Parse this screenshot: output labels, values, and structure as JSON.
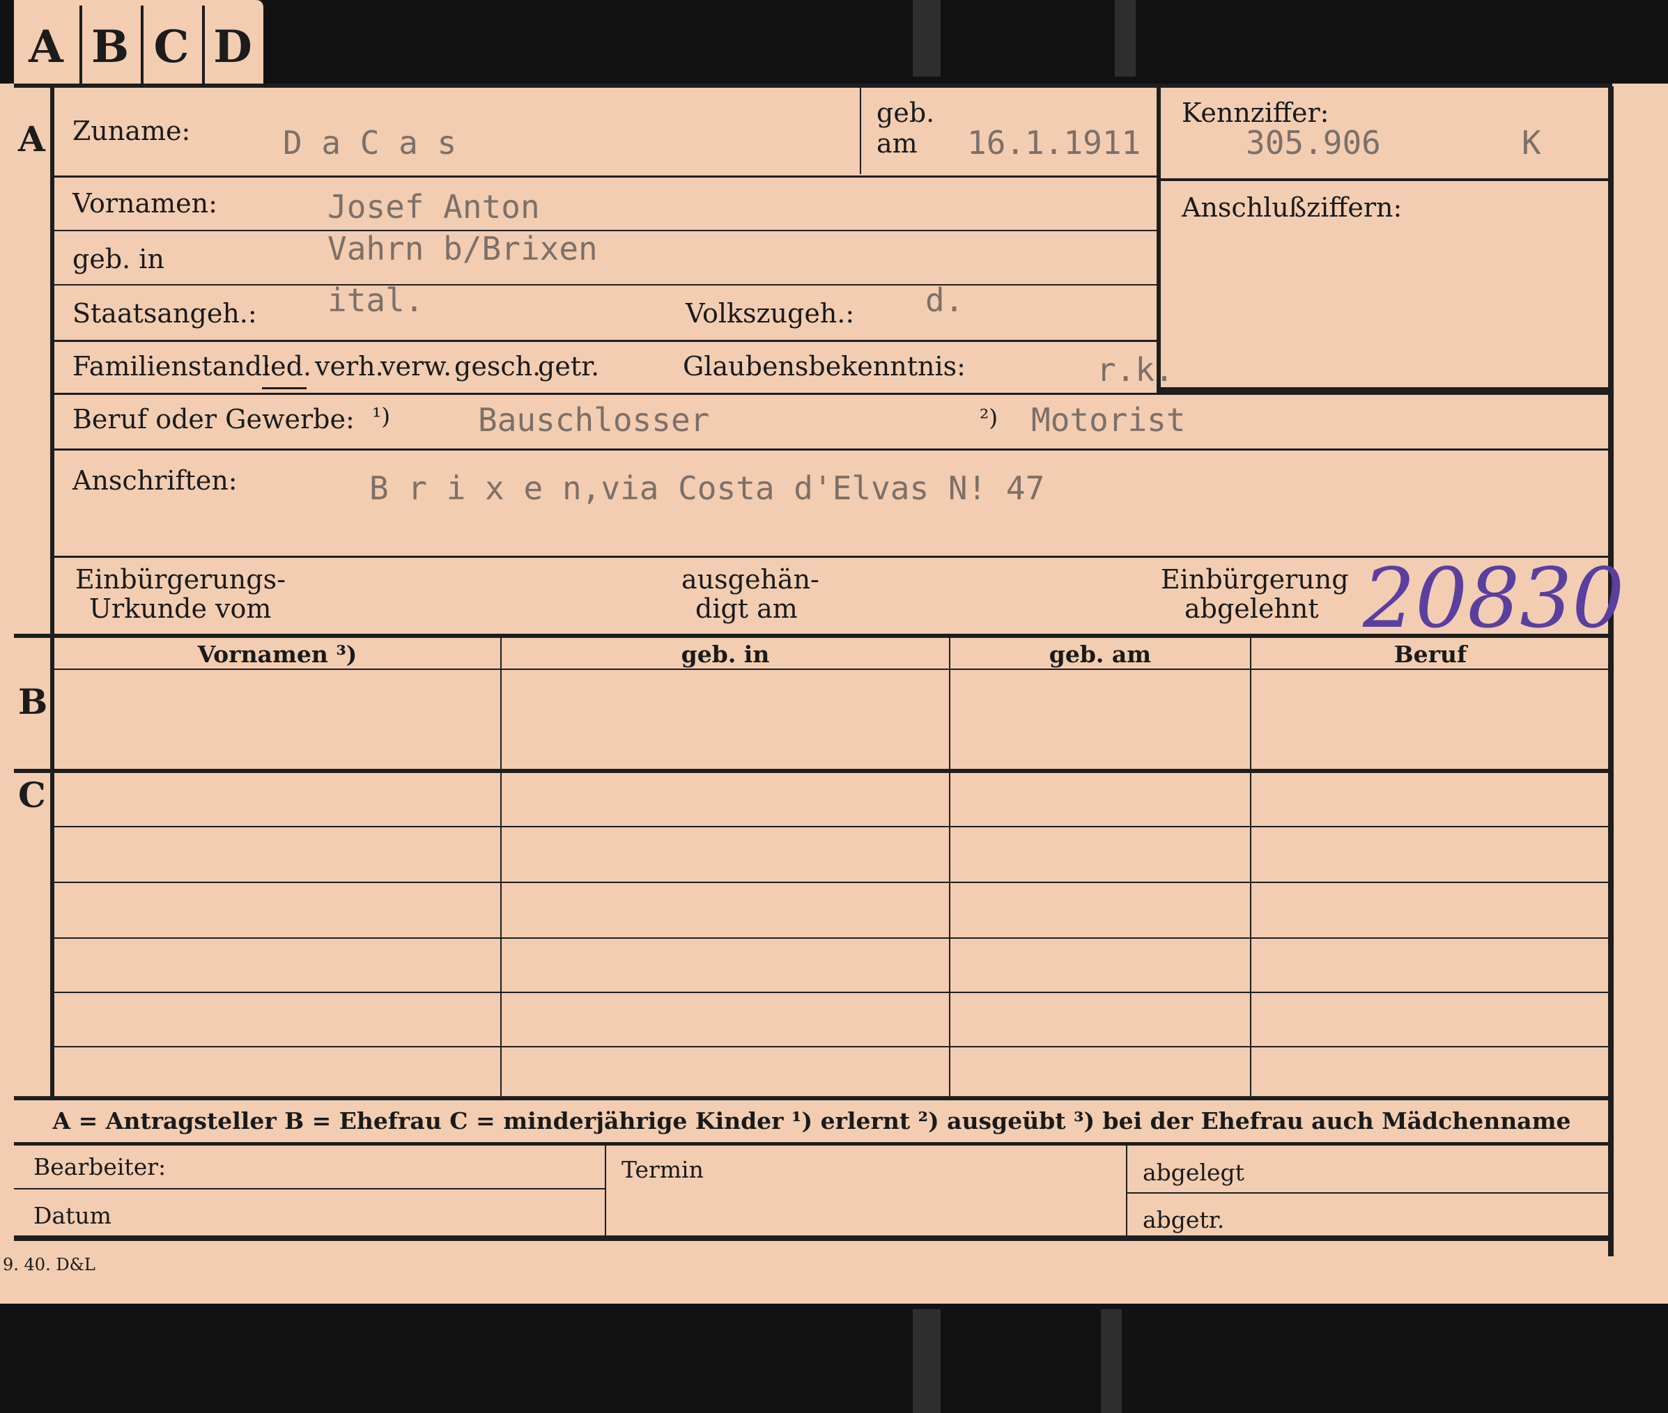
{
  "tabs": [
    "A",
    "B",
    "C",
    "D"
  ],
  "sections": {
    "a": "A",
    "b": "B",
    "c": "C"
  },
  "labels": {
    "zuname": "Zuname:",
    "geb_am_top": "geb.",
    "geb_am_bottom": "am",
    "kennziffer": "Kennziffer:",
    "anschlussziffern": "Anschlußziffern:",
    "vornamen": "Vornamen:",
    "geb_in": "geb. in",
    "staatsangeh": "Staatsangeh.:",
    "volkszugeh": "Volkszugeh.:",
    "familienstand": "Familienstand:",
    "familienstand_options": [
      "led.",
      "verh.",
      "verw.",
      "gesch.",
      "getr."
    ],
    "glaubensbekenntnis": "Glaubensbekenntnis:",
    "beruf": "Beruf oder Gewerbe:",
    "beruf_note1": "¹)",
    "beruf_note2": "²)",
    "anschriften": "Anschriften:",
    "urkunde_1": "Einbürgerungs-",
    "urkunde_2": "Urkunde vom",
    "ausgehaendigt_1": "ausgehän-",
    "ausgehaendigt_2": "digt am",
    "abgelehnt_1": "Einbürgerung",
    "abgelehnt_2": "abgelehnt"
  },
  "values": {
    "zuname": "D a C a s",
    "geb_am": "16.1.1911",
    "kennziffer": "305.906",
    "kennziffer_suffix": "K",
    "vornamen": "Josef Anton",
    "geb_in": "Vahrn b/Brixen",
    "staatsangeh": "ital.",
    "volkszugeh": "d.",
    "glaubensbekenntnis": "r.k.",
    "beruf_erlernt": "Bauschlosser",
    "beruf_ausgeuebt": "Motorist",
    "anschrift": "B r i x e n,via Costa d'Elvas N! 47",
    "stamp_number": "20830"
  },
  "family_table": {
    "headers": [
      "Vornamen ³)",
      "geb. in",
      "geb. am",
      "Beruf"
    ]
  },
  "legend": "A = Antragsteller   B = Ehefrau   C = minderjährige Kinder   ¹) erlernt   ²) ausgeübt   ³) bei der Ehefrau auch Mädchenname",
  "footer": {
    "bearbeiter": "Bearbeiter:",
    "termin": "Termin",
    "abgelegt": "abgelegt",
    "datum": "Datum",
    "abgetr": "abgetr."
  },
  "print_code": "9. 40. D&L",
  "colors": {
    "card": "#f2cdb2",
    "ink": "#1a1a1a",
    "typewriter": "#7c7068",
    "stamp": "#5a3f9e"
  }
}
